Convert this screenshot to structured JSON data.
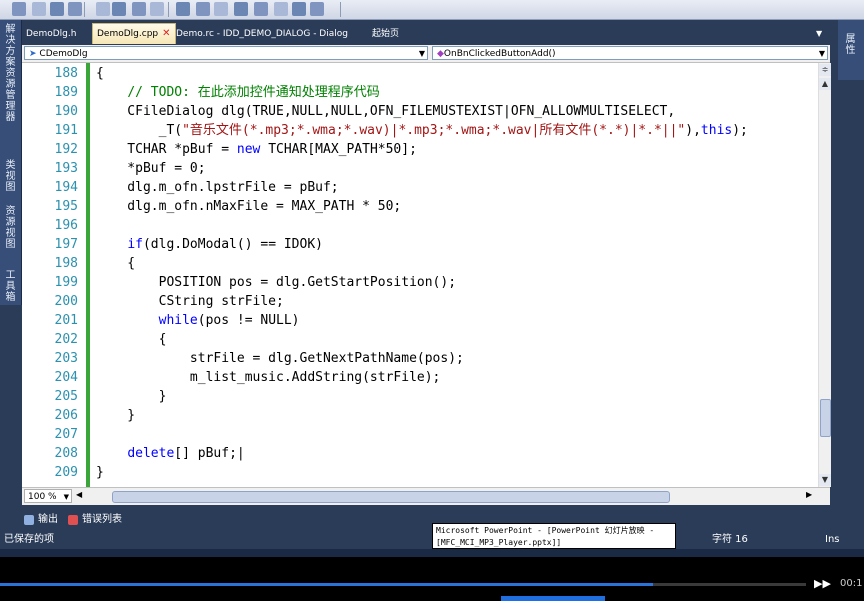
{
  "toolbar": {
    "icons": [
      "tb-icon-1",
      "tb-icon-2",
      "tb-icon-3",
      "tb-icon-4",
      "tb-icon-5",
      "tb-icon-6",
      "tb-icon-7",
      "tb-icon-8",
      "tb-icon-9",
      "tb-icon-10",
      "tb-icon-11",
      "tb-icon-12",
      "tb-icon-13",
      "tb-icon-14",
      "tb-icon-15",
      "tb-icon-16"
    ]
  },
  "left_sidebar": {
    "items": [
      {
        "label": "解决方案资源管理器"
      },
      {
        "label": "类视图"
      },
      {
        "label": "资源视图"
      },
      {
        "label": "工具箱"
      }
    ]
  },
  "right_sidebar": {
    "items": [
      {
        "label": "属性"
      }
    ]
  },
  "tabs": [
    {
      "label": "DemoDlg.h",
      "active": false
    },
    {
      "label": "DemoDlg.cpp",
      "active": true
    },
    {
      "label": "Demo.rc - IDD_DEMO_DIALOG - Dialog",
      "active": false
    },
    {
      "label": "起始页",
      "active": false
    }
  ],
  "nav": {
    "class_combo": "CDemoDlg",
    "method_combo": "OnBnClickedButtonAdd()"
  },
  "code_lines": [
    {
      "num": "188",
      "code": "{"
    },
    {
      "num": "189",
      "code": "    // TODO: 在此添加控件通知处理程序代码"
    },
    {
      "num": "190",
      "code": "    CFileDialog dlg(TRUE,NULL,NULL,OFN_FILEMUSTEXIST|OFN_ALLOWMULTISELECT,"
    },
    {
      "num": "191",
      "code": "        _T(\"音乐文件(*.mp3;*.wma;*.wav)|*.mp3;*.wma;*.wav|所有文件(*.*)|*.*||\"),this);"
    },
    {
      "num": "192",
      "code": "    TCHAR *pBuf = new TCHAR[MAX_PATH*50];"
    },
    {
      "num": "193",
      "code": "    *pBuf = 0;"
    },
    {
      "num": "194",
      "code": "    dlg.m_ofn.lpstrFile = pBuf;"
    },
    {
      "num": "195",
      "code": "    dlg.m_ofn.nMaxFile = MAX_PATH * 50;"
    },
    {
      "num": "196",
      "code": ""
    },
    {
      "num": "197",
      "code": "    if(dlg.DoModal() == IDOK)"
    },
    {
      "num": "198",
      "code": "    {"
    },
    {
      "num": "199",
      "code": "        POSITION pos = dlg.GetStartPosition();"
    },
    {
      "num": "200",
      "code": "        CString strFile;"
    },
    {
      "num": "201",
      "code": "        while(pos != NULL)"
    },
    {
      "num": "202",
      "code": "        {"
    },
    {
      "num": "203",
      "code": "            strFile = dlg.GetNextPathName(pos);"
    },
    {
      "num": "204",
      "code": "            m_list_music.AddString(strFile);"
    },
    {
      "num": "205",
      "code": "        }"
    },
    {
      "num": "206",
      "code": "    }"
    },
    {
      "num": "207",
      "code": ""
    },
    {
      "num": "208",
      "code": "    delete[] pBuf;|"
    },
    {
      "num": "209",
      "code": "}"
    }
  ],
  "zoom": "100 %",
  "bottom_tabs": [
    {
      "label": "输出"
    },
    {
      "label": "错误列表"
    }
  ],
  "status": {
    "text": "已保存的项",
    "char": "字符 16",
    "mode": "Ins"
  },
  "tooltip": {
    "line1": "Microsoft PowerPoint - [PowerPoint 幻灯片放映 -",
    "line2": "[MFC_MCI_MP3_Player.pptx]]"
  },
  "player": {
    "progress": 0.81,
    "time": "00:1",
    "button_glyph": "▶▶"
  },
  "colors": {
    "keyword": "#0000ff",
    "comment": "#008000",
    "string": "#a31515",
    "line_number": "#2b91af",
    "change_bar": "#3aa63a"
  }
}
